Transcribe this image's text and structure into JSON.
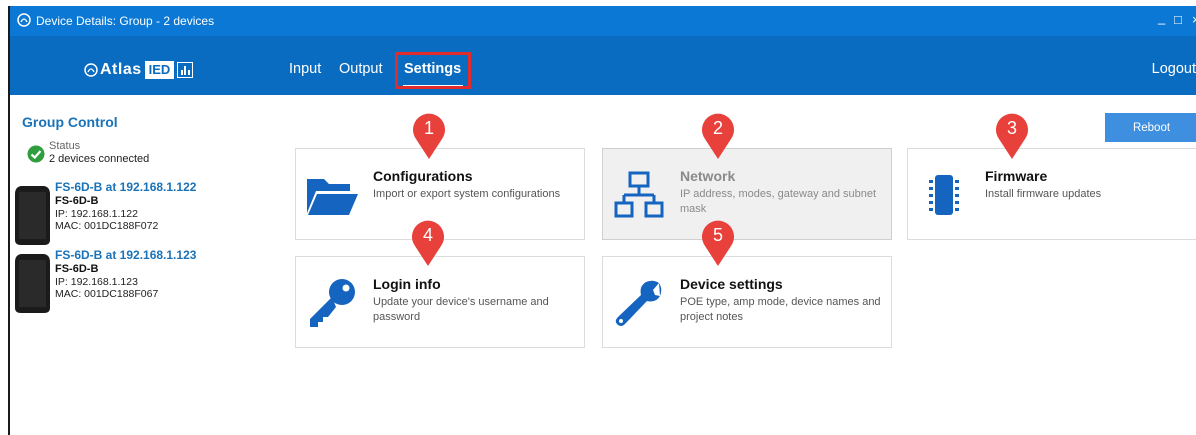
{
  "window": {
    "title": "Device Details: Group - 2 devices",
    "minimize": "_",
    "maximize": "□",
    "close": "×"
  },
  "nav": {
    "logo_text": "Atlas",
    "logo_ied": "IED",
    "tabs": [
      {
        "label": "Input"
      },
      {
        "label": "Output"
      },
      {
        "label": "Settings",
        "active": true
      }
    ],
    "logout": "Logout"
  },
  "sidebar": {
    "title": "Group Control",
    "status_label": "Status",
    "status_text": "2 devices connected",
    "devices": [
      {
        "name": "FS-6D-B at 192.168.1.122",
        "model": "FS-6D-B",
        "ip": "IP: 192.168.1.122",
        "mac": "MAC: 001DC188F072"
      },
      {
        "name": "FS-6D-B at 192.168.1.123",
        "model": "FS-6D-B",
        "ip": "IP: 192.168.1.123",
        "mac": "MAC: 001DC188F067"
      }
    ]
  },
  "reboot_label": "Reboot",
  "cards": [
    {
      "title": "Configurations",
      "description": "Import or export system configurations",
      "icon": "folder-icon"
    },
    {
      "title": "Network",
      "description": "IP address, modes, gateway and subnet mask",
      "icon": "network-icon",
      "disabled": true
    },
    {
      "title": "Firmware",
      "description": "Install firmware updates",
      "icon": "chip-icon"
    },
    {
      "title": "Login info",
      "description": "Update your device's username and password",
      "icon": "key-icon"
    },
    {
      "title": "Device settings",
      "description": "POE type, amp mode, device names and project notes",
      "icon": "wrench-icon"
    }
  ],
  "markers": [
    "1",
    "2",
    "3",
    "4",
    "5"
  ],
  "colors": {
    "titlebar": "#0a78d4",
    "nav": "#0a6cc0",
    "accent": "#1a73b8",
    "marker": "#e8413c",
    "highlight": "#e02c2c",
    "status_ok": "#2e9e3e"
  }
}
